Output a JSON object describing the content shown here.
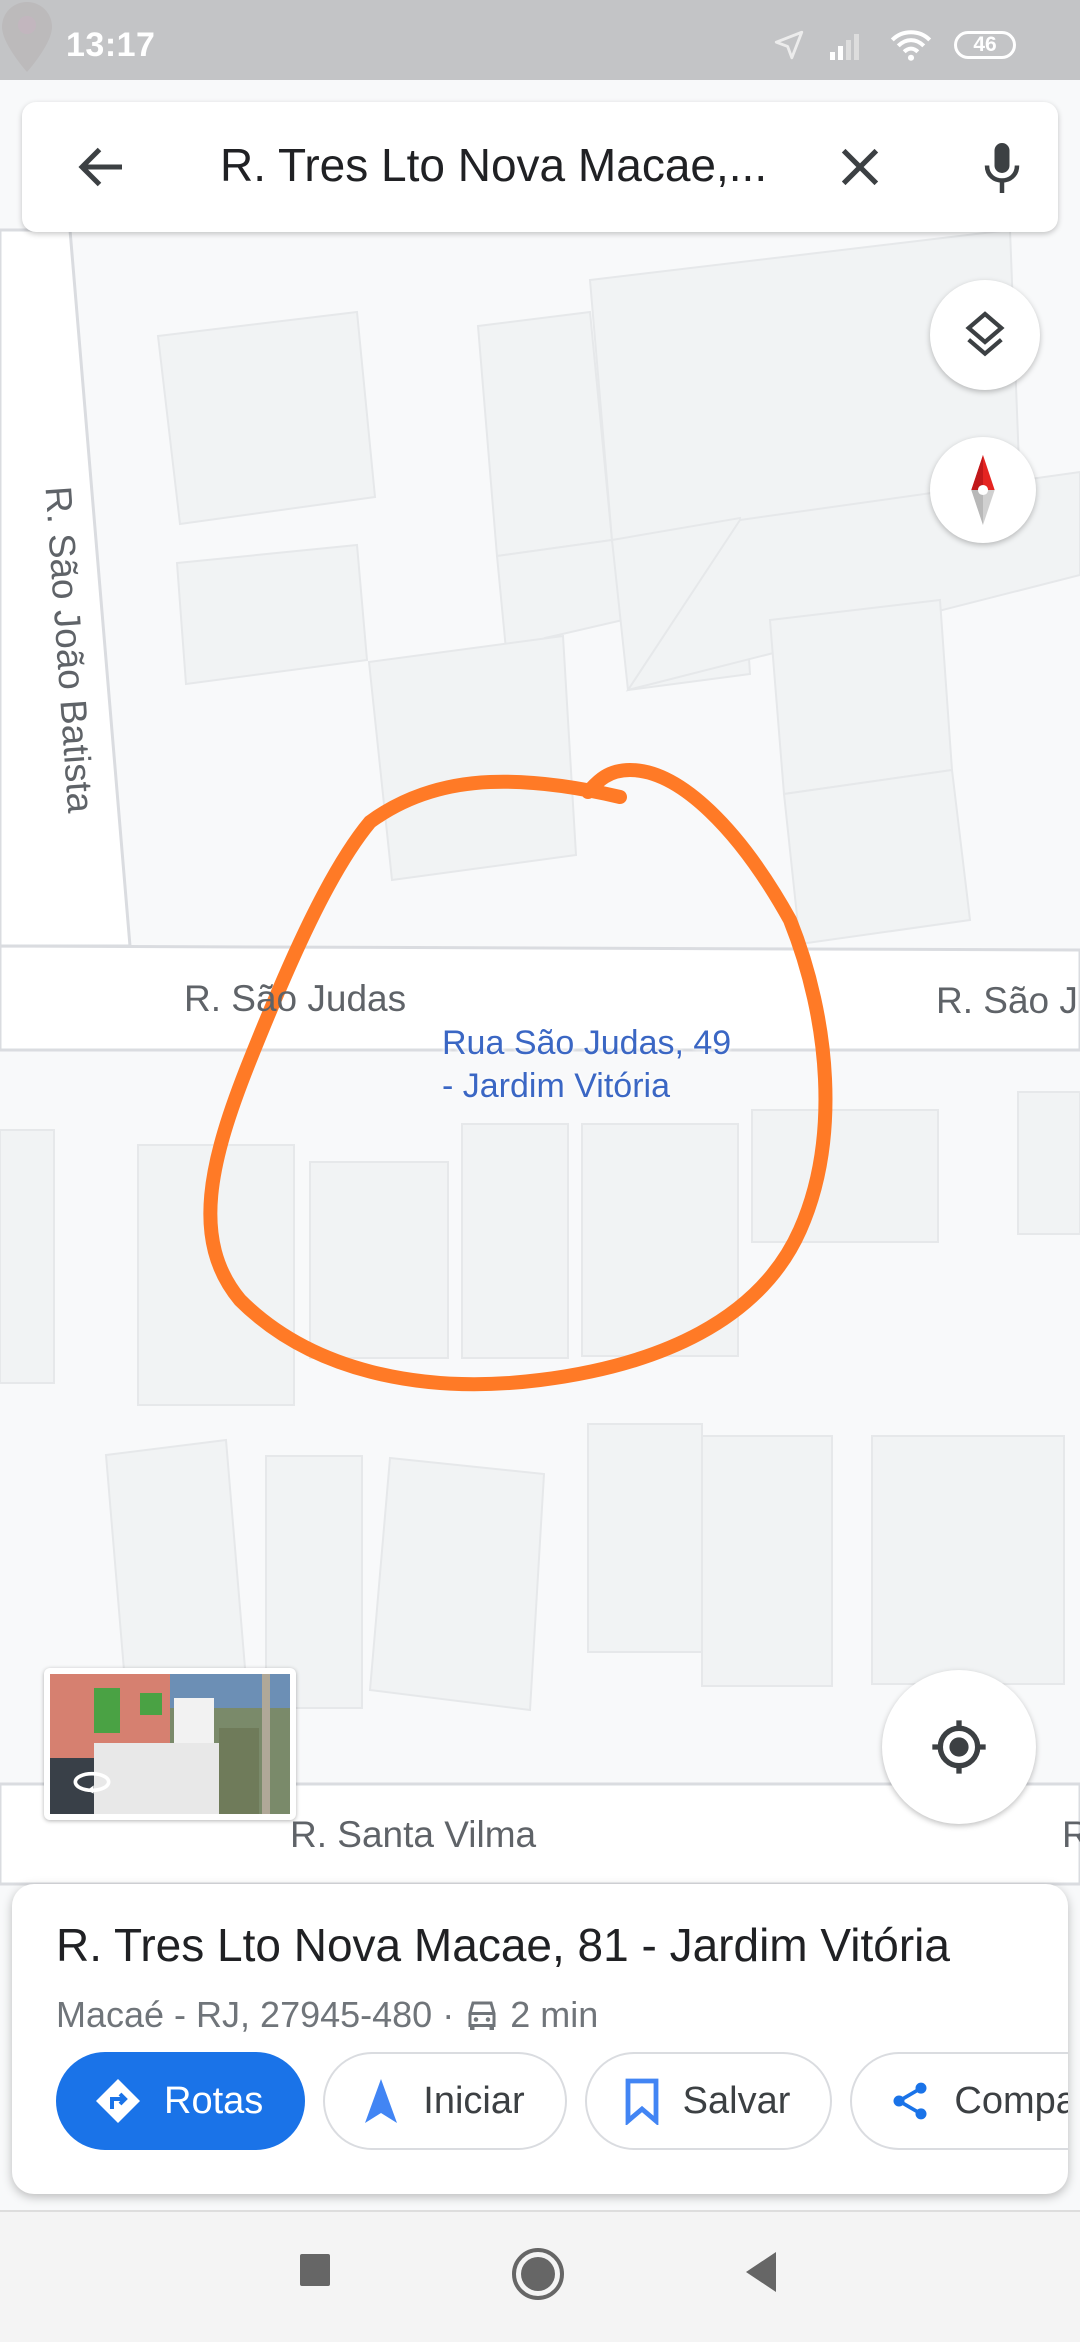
{
  "status_bar": {
    "time": "13:17",
    "battery_level": "46",
    "icons": [
      "location-arrow-icon",
      "signal-icon",
      "wifi-icon",
      "battery-icon"
    ]
  },
  "search": {
    "query": "R. Tres Lto Nova Macae,...",
    "back_icon": "arrow-left-icon",
    "clear_icon": "close-icon",
    "mic_icon": "microphone-icon"
  },
  "map": {
    "streets": {
      "sao_joao_batista": "R. São João Batista",
      "sao_judas_left": "R. São Judas",
      "sao_judas_right": "R. São J",
      "santa_vilma": "R. Santa Vilma",
      "right_edge_partial": "R"
    },
    "pin": {
      "line1": "Rua São Judas, 49",
      "line2": "- Jardim Vitória"
    },
    "annotation_color": "#ff7a26",
    "pin_color": "#a67d72",
    "pin_dot_color": "#f14b9a"
  },
  "controls": {
    "layers": "layers-icon",
    "compass": "compass-icon",
    "my_location": "my-location-icon",
    "street_view": "street-view-thumbnail"
  },
  "place_card": {
    "title": "R. Tres Lto Nova Macae, 81 - Jardim Vitória",
    "address": "Macaé - RJ, 27945-480",
    "separator": "·",
    "drive_time": "2 min",
    "actions": [
      {
        "label": "Rotas",
        "icon": "directions-icon",
        "primary": true
      },
      {
        "label": "Iniciar",
        "icon": "navigation-arrow-icon",
        "primary": false
      },
      {
        "label": "Salvar",
        "icon": "bookmark-icon",
        "primary": false
      },
      {
        "label": "Compartilhar",
        "icon": "share-icon",
        "primary": false
      }
    ],
    "accent_color": "#1a73e8"
  },
  "nav_bar": {
    "buttons": [
      "recents-button",
      "home-button",
      "back-button"
    ]
  }
}
